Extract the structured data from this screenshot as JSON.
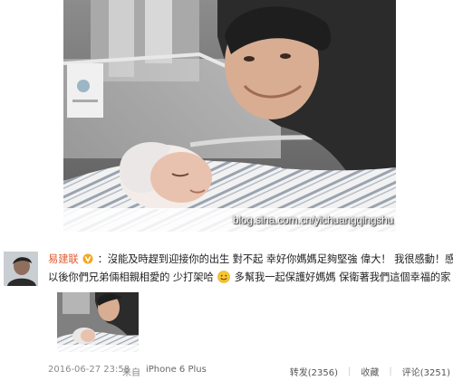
{
  "photo": {
    "watermark": "blog.sina.com.cn/yichuangqingshu"
  },
  "post": {
    "username": "易建联",
    "line1": "：沒能及時趕到迎接你的出生 對不起 幸好你媽媽足夠堅強 偉大！ 我很感動！感恩！",
    "line2a": "以後你們兄弟倆相親相愛的 少打架哈",
    "line2b": "多幫我一起保護好媽媽 保衛著我們這個幸福的家"
  },
  "footer": {
    "time": "2016-06-27 23:58",
    "source_prefix": "来自",
    "source": "iPhone 6 Plus",
    "repost": "转发(2356)",
    "favorite": "收藏",
    "comment": "评论(3251)"
  },
  "colors": {
    "username": "#e05a2f",
    "footer_text": "#8a8a8a",
    "heart": "#d9262c",
    "badge": "#f5a623"
  },
  "icons": {
    "vip_badge": "vip-badge-icon",
    "smile": "smile-emoji-icon",
    "heart": "heart-emoji-icon"
  }
}
